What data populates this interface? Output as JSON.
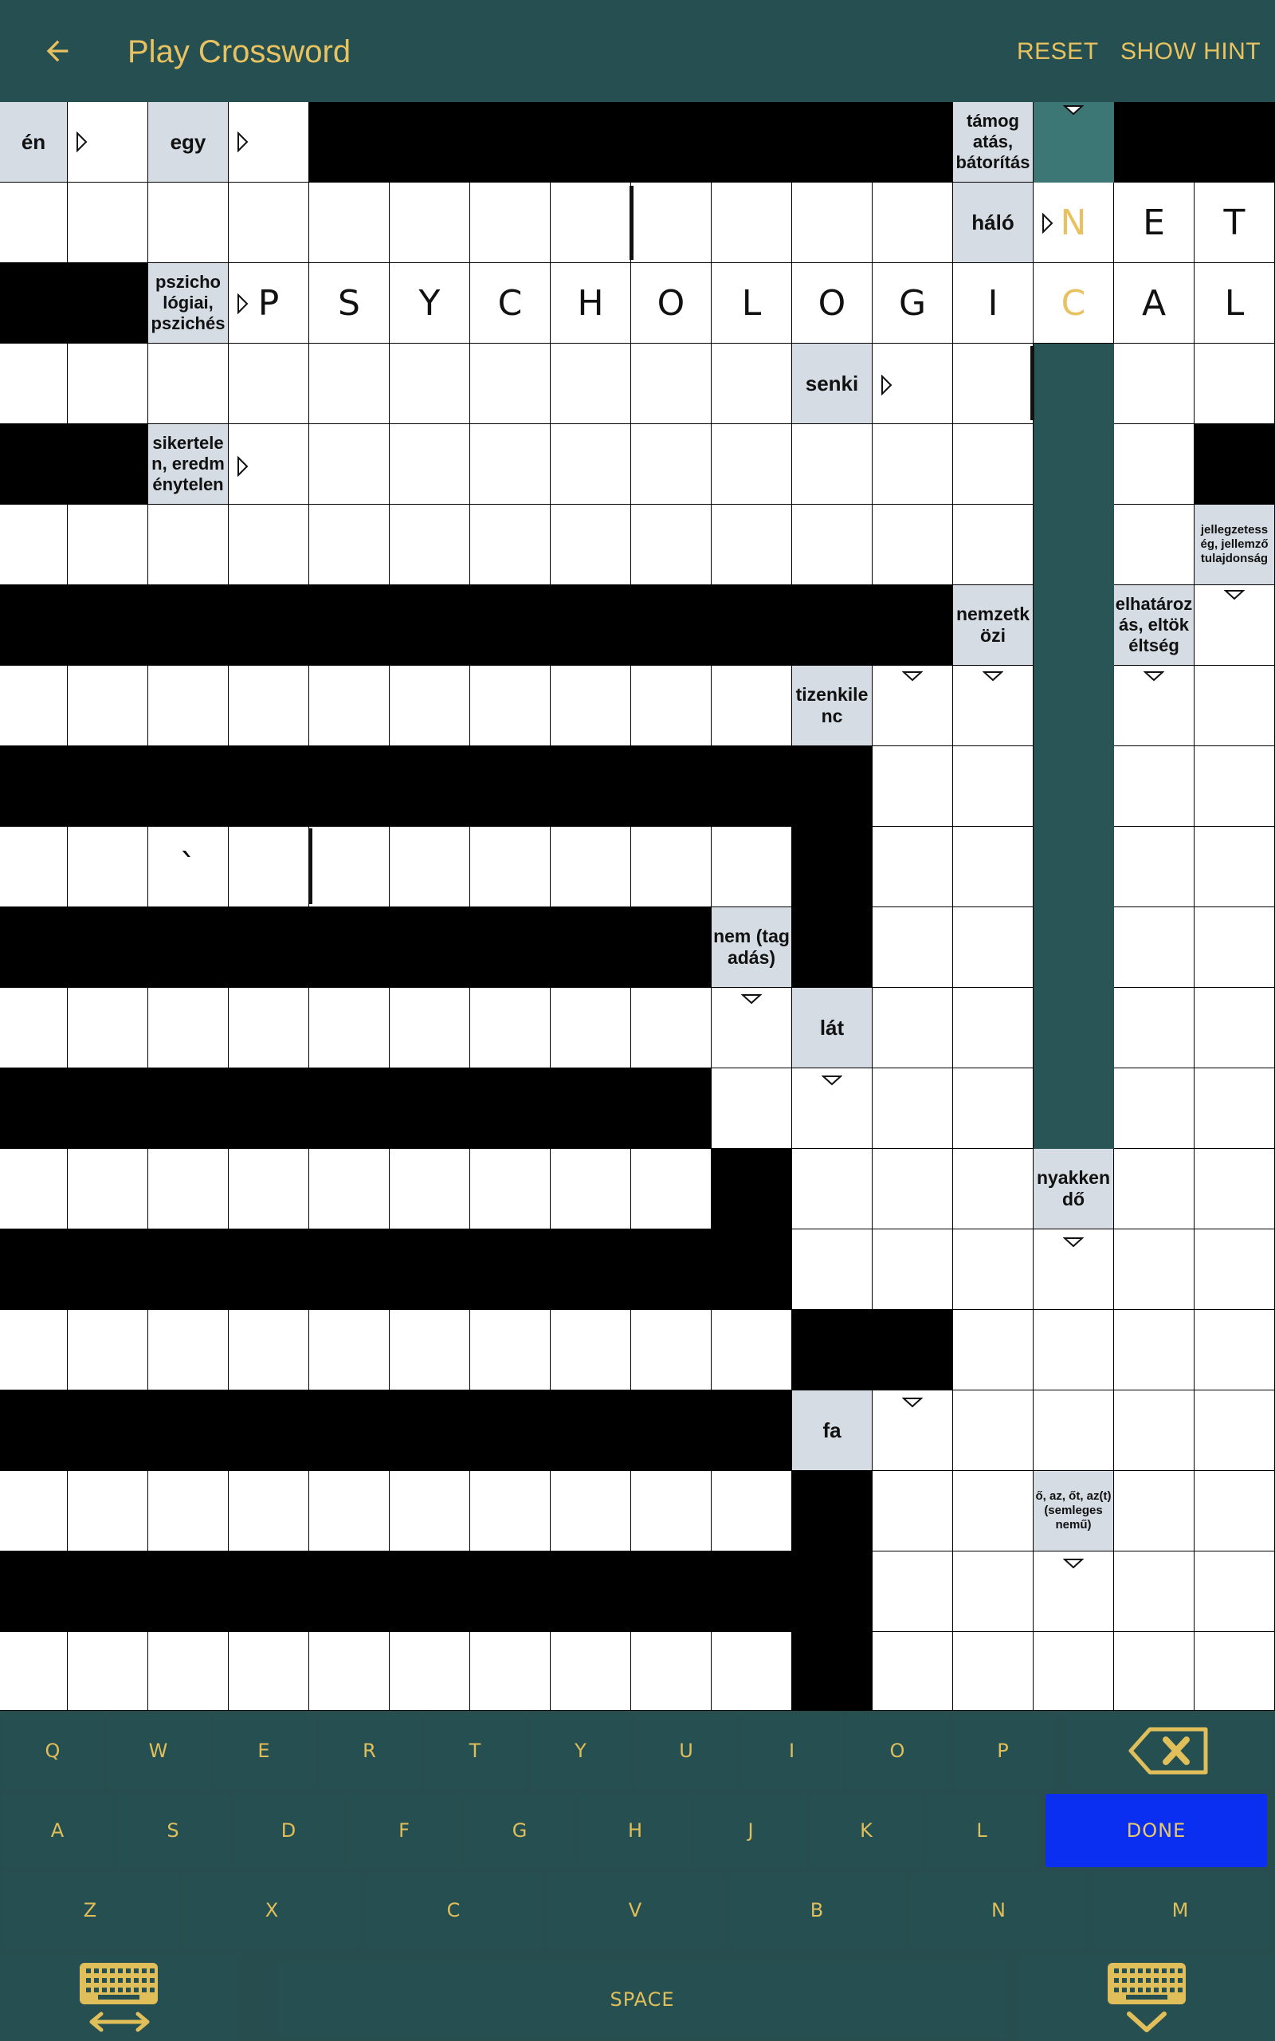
{
  "app_bar": {
    "title": "Play Crossword",
    "reset_label": "RESET",
    "hint_label": "SHOW HINT",
    "background": "#254f50",
    "text_color": "#e8c260",
    "back_icon": "arrow-left-icon"
  },
  "grid": {
    "columns": 16,
    "rows": 20,
    "highlight_color": "#2a5556",
    "current_cell_color": "#3d7775",
    "clue_background": "#d5dce3",
    "block_color": "#000000",
    "selected_word": "NETCAL",
    "clues": [
      {
        "row": 0,
        "col": 0,
        "text": "én"
      },
      {
        "row": 0,
        "col": 2,
        "text": "egy"
      },
      {
        "row": 0,
        "col": 12,
        "text": "támog atás, bátorítás"
      },
      {
        "row": 1,
        "col": 12,
        "text": "háló"
      },
      {
        "row": 2,
        "col": 2,
        "text": "pszicho lógiai, pszichés"
      },
      {
        "row": 3,
        "col": 10,
        "text": "senki"
      },
      {
        "row": 4,
        "col": 2,
        "text": "sikertele n, eredm énytelen"
      },
      {
        "row": 5,
        "col": 15,
        "text": "jellegzetess ég, jellemző tulajdonság"
      },
      {
        "row": 6,
        "col": 12,
        "text": "nemzetk özi"
      },
      {
        "row": 6,
        "col": 14,
        "text": "elhatároz ás, eltök éltség"
      },
      {
        "row": 7,
        "col": 10,
        "text": "tizenkile nc"
      },
      {
        "row": 10,
        "col": 9,
        "text": "nem (tag adás)"
      },
      {
        "row": 11,
        "col": 10,
        "text": "lát"
      },
      {
        "row": 13,
        "col": 13,
        "text": "nyakken dő"
      },
      {
        "row": 16,
        "col": 10,
        "text": "fa"
      },
      {
        "row": 17,
        "col": 13,
        "text": "ő, az, őt, az(t) (semleges nemű)"
      }
    ],
    "letters": [
      {
        "row": 1,
        "col": 13,
        "char": "N"
      },
      {
        "row": 1,
        "col": 14,
        "char": "E"
      },
      {
        "row": 1,
        "col": 15,
        "char": "T"
      },
      {
        "row": 2,
        "col": 3,
        "char": "P"
      },
      {
        "row": 2,
        "col": 4,
        "char": "S"
      },
      {
        "row": 2,
        "col": 5,
        "char": "Y"
      },
      {
        "row": 2,
        "col": 6,
        "char": "C"
      },
      {
        "row": 2,
        "col": 7,
        "char": "H"
      },
      {
        "row": 2,
        "col": 8,
        "char": "O"
      },
      {
        "row": 2,
        "col": 9,
        "char": "L"
      },
      {
        "row": 2,
        "col": 10,
        "char": "O"
      },
      {
        "row": 2,
        "col": 11,
        "char": "G"
      },
      {
        "row": 2,
        "col": 12,
        "char": "I"
      },
      {
        "row": 2,
        "col": 13,
        "char": "C"
      },
      {
        "row": 2,
        "col": 14,
        "char": "A"
      },
      {
        "row": 2,
        "col": 15,
        "char": "L"
      },
      {
        "row": 9,
        "col": 2,
        "char": "`"
      }
    ]
  },
  "keyboard": {
    "row1": [
      "Q",
      "W",
      "E",
      "R",
      "T",
      "Y",
      "U",
      "I",
      "O",
      "P"
    ],
    "row2": [
      "A",
      "S",
      "D",
      "F",
      "G",
      "H",
      "J",
      "K",
      "L"
    ],
    "row3": [
      "Z",
      "X",
      "C",
      "V",
      "B",
      "N",
      "M"
    ],
    "done_label": "DONE",
    "space_label": "SPACE",
    "backspace_icon": "backspace-icon",
    "switch_keyboard_icon": "keyboard-switch-icon",
    "hide_keyboard_icon": "keyboard-hide-icon",
    "key_color": "#254f50",
    "key_text_color": "#e0bf5a",
    "done_color": "#0a2ff0"
  }
}
